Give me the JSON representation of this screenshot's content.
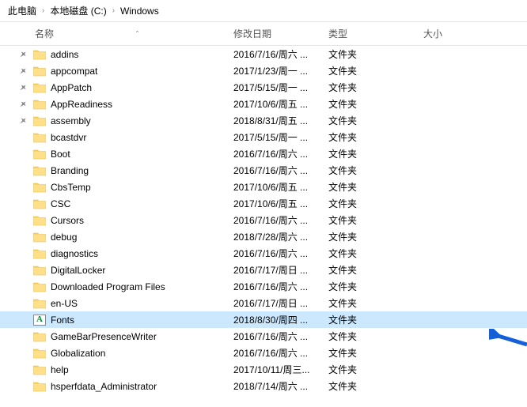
{
  "breadcrumb": {
    "seg1": "此电脑",
    "seg2": "本地磁盘 (C:)",
    "seg3": "Windows"
  },
  "headers": {
    "name": "名称",
    "date": "修改日期",
    "type": "类型",
    "size": "大小"
  },
  "type_folder": "文件夹",
  "selected_index": 15,
  "pinned_count": 5,
  "items": [
    {
      "name": "addins",
      "date": "2016/7/16/周六 ...",
      "icon": "folder"
    },
    {
      "name": "appcompat",
      "date": "2017/1/23/周一 ...",
      "icon": "folder"
    },
    {
      "name": "AppPatch",
      "date": "2017/5/15/周一 ...",
      "icon": "folder"
    },
    {
      "name": "AppReadiness",
      "date": "2017/10/6/周五 ...",
      "icon": "folder"
    },
    {
      "name": "assembly",
      "date": "2018/8/31/周五 ...",
      "icon": "folder"
    },
    {
      "name": "bcastdvr",
      "date": "2017/5/15/周一 ...",
      "icon": "folder"
    },
    {
      "name": "Boot",
      "date": "2016/7/16/周六 ...",
      "icon": "folder"
    },
    {
      "name": "Branding",
      "date": "2016/7/16/周六 ...",
      "icon": "folder"
    },
    {
      "name": "CbsTemp",
      "date": "2017/10/6/周五 ...",
      "icon": "folder"
    },
    {
      "name": "CSC",
      "date": "2017/10/6/周五 ...",
      "icon": "folder"
    },
    {
      "name": "Cursors",
      "date": "2016/7/16/周六 ...",
      "icon": "folder"
    },
    {
      "name": "debug",
      "date": "2018/7/28/周六 ...",
      "icon": "folder"
    },
    {
      "name": "diagnostics",
      "date": "2016/7/16/周六 ...",
      "icon": "folder"
    },
    {
      "name": "DigitalLocker",
      "date": "2016/7/17/周日 ...",
      "icon": "folder"
    },
    {
      "name": "Downloaded Program Files",
      "date": "2016/7/16/周六 ...",
      "icon": "folder"
    },
    {
      "name": "en-US",
      "date": "2016/7/17/周日 ...",
      "icon": "folder"
    },
    {
      "name": "Fonts",
      "date": "2018/8/30/周四 ...",
      "icon": "fonts"
    },
    {
      "name": "GameBarPresenceWriter",
      "date": "2016/7/16/周六 ...",
      "icon": "folder"
    },
    {
      "name": "Globalization",
      "date": "2016/7/16/周六 ...",
      "icon": "folder"
    },
    {
      "name": "help",
      "date": "2017/10/11/周三...",
      "icon": "folder"
    },
    {
      "name": "hsperfdata_Administrator",
      "date": "2018/7/14/周六 ...",
      "icon": "folder"
    }
  ]
}
